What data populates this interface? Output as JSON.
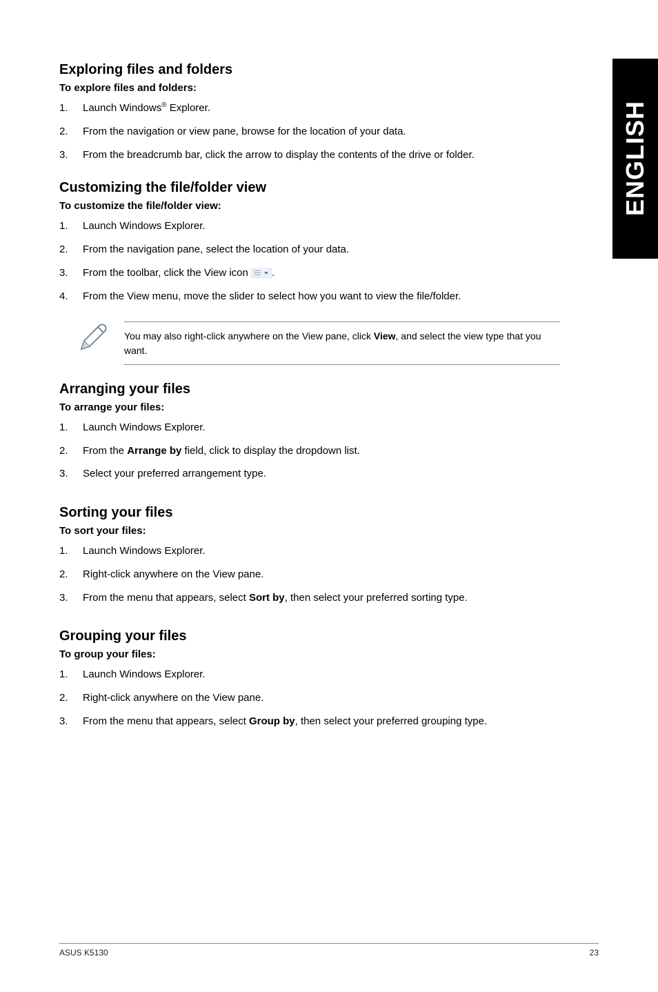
{
  "side_tab": "ENGLISH",
  "exploring": {
    "heading": "Exploring files and folders",
    "sub": "To explore files and folders:",
    "s1n": "1.",
    "s1a": "Launch Windows",
    "s1b": " Explorer.",
    "s2n": "2.",
    "s2": "From the navigation or view pane, browse for the location of your data.",
    "s3n": "3.",
    "s3": "From the breadcrumb bar, click the arrow to display the contents of the drive or folder."
  },
  "customizing": {
    "heading": "Customizing the file/folder view",
    "sub": "To customize the file/folder view:",
    "s1n": "1.",
    "s1": "Launch Windows Explorer.",
    "s2n": "2.",
    "s2": "From the navigation pane, select the location of your data.",
    "s3n": "3.",
    "s3a": "From the toolbar, click the View icon ",
    "s3b": ".",
    "s4n": "4.",
    "s4": "From the View menu, move the slider to select how you want to view the file/folder."
  },
  "note": {
    "a": "You may also right-click anywhere on the View pane, click ",
    "b": "View",
    "c": ", and select the view type that you want."
  },
  "arranging": {
    "heading": "Arranging your files",
    "sub": "To arrange your files:",
    "s1n": "1.",
    "s1": "Launch Windows Explorer.",
    "s2n": "2.",
    "s2a": "From the ",
    "s2b": "Arrange by",
    "s2c": " field, click to display the dropdown list.",
    "s3n": "3.",
    "s3": "Select your preferred arrangement type."
  },
  "sorting": {
    "heading": "Sorting your files",
    "sub": "To sort your files:",
    "s1n": "1.",
    "s1": "Launch Windows Explorer.",
    "s2n": "2.",
    "s2": "Right-click anywhere on the View pane.",
    "s3n": "3.",
    "s3a": "From the menu that appears, select ",
    "s3b": "Sort by",
    "s3c": ", then select your preferred sorting type."
  },
  "grouping": {
    "heading": "Grouping your files",
    "sub": "To group your files:",
    "s1n": "1.",
    "s1": "Launch Windows Explorer.",
    "s2n": "2.",
    "s2": "Right-click anywhere on the View pane.",
    "s3n": "3.",
    "s3a": "From the menu that appears, select ",
    "s3b": "Group by",
    "s3c": ", then select your preferred grouping type."
  },
  "footer": {
    "left": "ASUS K5130",
    "right": "23"
  },
  "sup": "®"
}
